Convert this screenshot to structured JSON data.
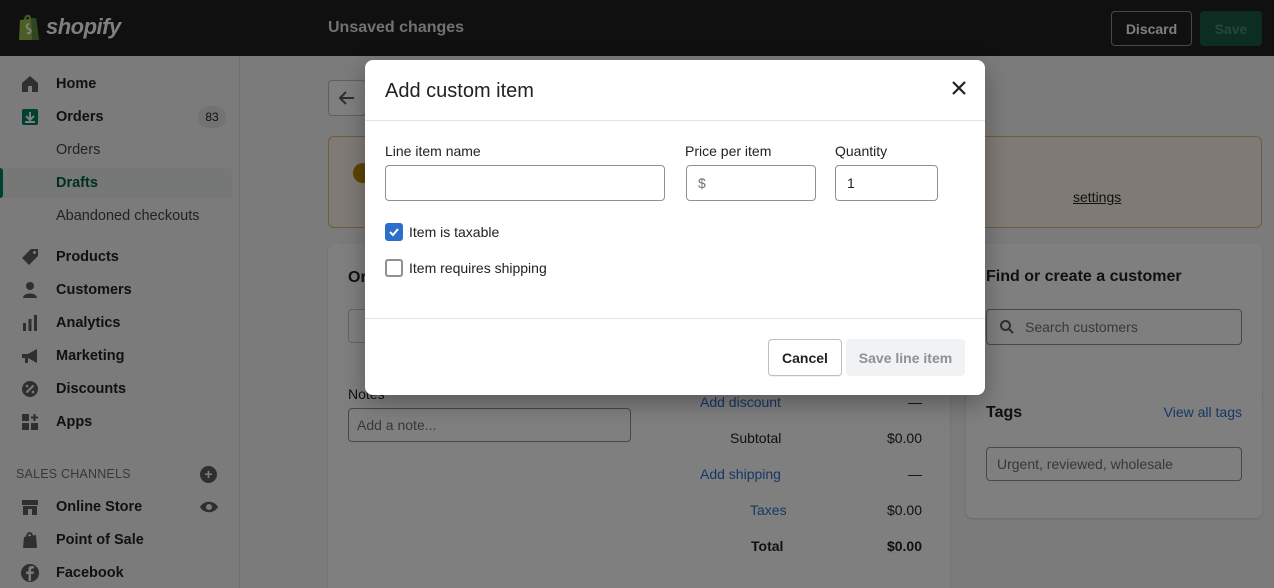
{
  "topbar": {
    "logo_text": "shopify",
    "status": "Unsaved changes",
    "discard_label": "Discard",
    "save_label": "Save"
  },
  "sidebar": {
    "items": [
      {
        "label": "Home",
        "icon": "home-icon"
      },
      {
        "label": "Orders",
        "icon": "orders-icon",
        "badge": "83"
      },
      {
        "label": "Orders",
        "sub": true
      },
      {
        "label": "Drafts",
        "sub": true,
        "active": true
      },
      {
        "label": "Abandoned checkouts",
        "sub": true
      },
      {
        "label": "Products",
        "icon": "tag-icon"
      },
      {
        "label": "Customers",
        "icon": "person-icon"
      },
      {
        "label": "Analytics",
        "icon": "bar-chart-icon"
      },
      {
        "label": "Marketing",
        "icon": "megaphone-icon"
      },
      {
        "label": "Discounts",
        "icon": "discount-icon"
      },
      {
        "label": "Apps",
        "icon": "apps-icon"
      }
    ],
    "sales_channels_heading": "SALES CHANNELS",
    "channels": [
      {
        "label": "Online Store",
        "icon": "store-icon"
      },
      {
        "label": "Point of Sale",
        "icon": "pos-icon"
      },
      {
        "label": "Facebook",
        "icon": "facebook-icon"
      }
    ]
  },
  "background": {
    "banner_link_fragment": "settings",
    "order_title_fragment": "Or",
    "notes_label": "Notes",
    "notes_placeholder": "Add a note...",
    "summary": {
      "add_discount": "Add discount",
      "discount_value": "—",
      "subtotal_label": "Subtotal",
      "subtotal_value": "$0.00",
      "add_shipping": "Add shipping",
      "shipping_value": "—",
      "taxes_label": "Taxes",
      "taxes_value": "$0.00",
      "total_label": "Total",
      "total_value": "$0.00"
    },
    "customer": {
      "title": "Find or create a customer",
      "search_placeholder": "Search customers"
    },
    "tags": {
      "title": "Tags",
      "view_all": "View all tags",
      "placeholder": "Urgent, reviewed, wholesale"
    }
  },
  "modal": {
    "title": "Add custom item",
    "line_item_name_label": "Line item name",
    "line_item_name_value": "",
    "price_label": "Price per item",
    "price_prefix": "$",
    "quantity_label": "Quantity",
    "quantity_value": "1",
    "taxable_label": "Item is taxable",
    "taxable_checked": true,
    "shipping_label": "Item requires shipping",
    "shipping_checked": false,
    "cancel_label": "Cancel",
    "save_label": "Save line item"
  },
  "colors": {
    "topbar_bg": "#202123",
    "accent_green": "#008060",
    "link_blue": "#2c6ecb",
    "checkbox_blue": "#2c6ecb",
    "warning_bg": "#fff5ea"
  }
}
